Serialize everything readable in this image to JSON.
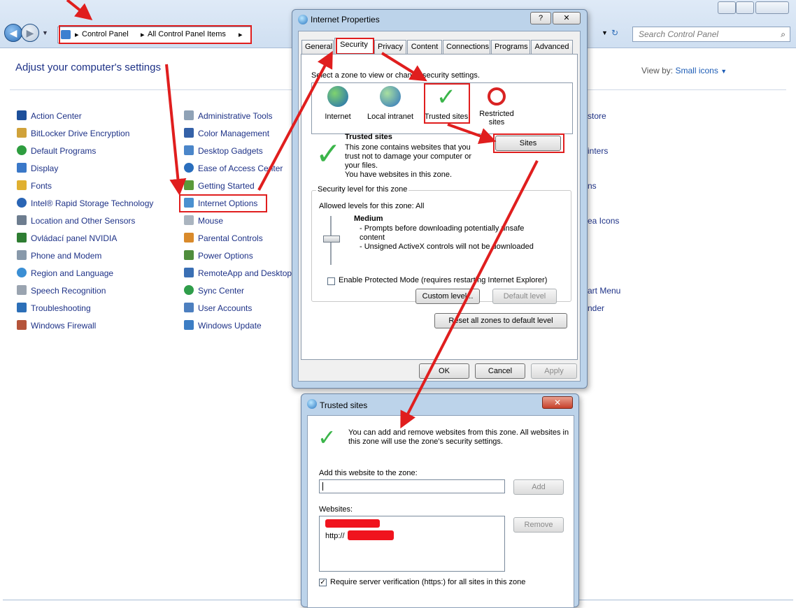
{
  "control_panel": {
    "breadcrumb": [
      "Control Panel",
      "All Control Panel Items"
    ],
    "search_placeholder": "Search Control Panel",
    "title": "Adjust your computer's settings",
    "view_by_label": "View by:",
    "view_by_value": "Small icons",
    "col1": [
      "Action Center",
      "BitLocker Drive Encryption",
      "Default Programs",
      "Display",
      "Fonts",
      "Intel® Rapid Storage Technology",
      "Location and Other Sensors",
      "Ovládací panel NVIDIA",
      "Phone and Modem",
      "Region and Language",
      "Speech Recognition",
      "Troubleshooting",
      "Windows Firewall"
    ],
    "col2": [
      "Administrative Tools",
      "Color Management",
      "Desktop Gadgets",
      "Ease of Access Center",
      "Getting Started",
      "Internet Options",
      "Mouse",
      "Parental Controls",
      "Power Options",
      "RemoteApp and Desktop",
      "Sync Center",
      "User Accounts",
      "Windows Update"
    ],
    "col3_partial": [
      "store",
      "",
      "inters",
      "",
      "ns",
      "",
      "ea Icons",
      "",
      "",
      "",
      "art Menu",
      "nder"
    ]
  },
  "internet_properties": {
    "title": "Internet Properties",
    "tabs": [
      "General",
      "Security",
      "Privacy",
      "Content",
      "Connections",
      "Programs",
      "Advanced"
    ],
    "zone_prompt": "Select a zone to view or change security settings.",
    "zones": [
      "Internet",
      "Local intranet",
      "Trusted sites",
      "Restricted sites"
    ],
    "selected_zone_title": "Trusted sites",
    "selected_zone_desc": [
      "This zone contains websites that you",
      "trust not to damage your computer or",
      "your files.",
      "You have websites in this zone."
    ],
    "sites_button": "Sites",
    "security_level_label": "Security level for this zone",
    "allowed_levels": "Allowed levels for this zone: All",
    "level_name": "Medium",
    "level_desc": [
      "- Prompts before downloading potentially unsafe",
      "content",
      "- Unsigned ActiveX controls will not be downloaded"
    ],
    "protected_mode_label": "Enable Protected Mode (requires restarting Internet Explorer)",
    "custom_level_button": "Custom level...",
    "default_level_button": "Default level",
    "reset_button": "Reset all zones to default level",
    "ok_button": "OK",
    "cancel_button": "Cancel",
    "apply_button": "Apply"
  },
  "trusted_sites": {
    "title": "Trusted sites",
    "info": [
      "You can add and remove websites from this zone. All websites in",
      "this zone will use the zone's security settings."
    ],
    "add_label": "Add this website to the zone:",
    "add_button": "Add",
    "websites_label": "Websites:",
    "website_prefix": "http://",
    "remove_button": "Remove",
    "verify_label": "Require server verification (https:) for all sites in this zone"
  },
  "colors": {
    "accent_red": "#e01e1e",
    "link_blue": "#1e3287"
  }
}
